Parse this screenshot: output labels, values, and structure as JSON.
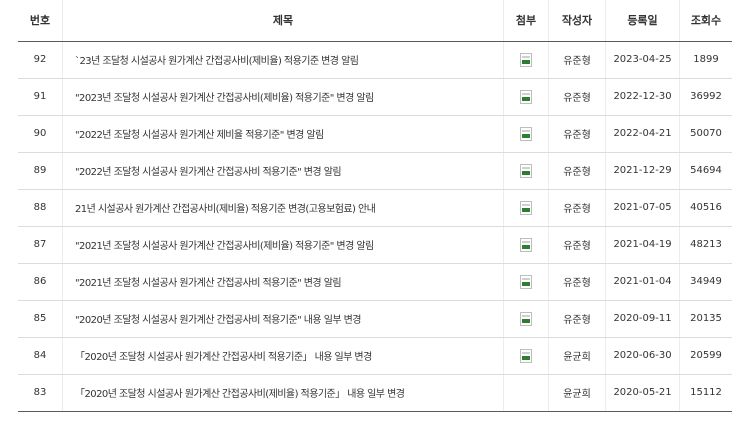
{
  "table": {
    "headers": {
      "number": "번호",
      "title": "제목",
      "attachment": "첨부",
      "author": "작성자",
      "date": "등록일",
      "views": "조회수"
    },
    "rows": [
      {
        "number": "92",
        "title": "`23년 조달청 시설공사 원가계산 간접공사비(제비율) 적용기준 변경 알림",
        "author": "유준형",
        "date": "2023-04-25",
        "views": "1899",
        "attachment": true
      },
      {
        "number": "91",
        "title": "\"2023년 조달청 시설공사 원가계산 간접공사비(제비율) 적용기준\" 변경 알림",
        "author": "유준형",
        "date": "2022-12-30",
        "views": "36992",
        "attachment": true
      },
      {
        "number": "90",
        "title": "\"2022년 조달청 시설공사 원가계산 제비율 적용기준\" 변경 알림",
        "author": "유준형",
        "date": "2022-04-21",
        "views": "50070",
        "attachment": true
      },
      {
        "number": "89",
        "title": "\"2022년 조달청 시설공사 원가계산 간접공사비 적용기준\" 변경 알림",
        "author": "유준형",
        "date": "2021-12-29",
        "views": "54694",
        "attachment": true
      },
      {
        "number": "88",
        "title": "21년 시설공사 원가계산 간접공사비(제비율) 적용기준 변경(고용보험료) 안내",
        "author": "유준형",
        "date": "2021-07-05",
        "views": "40516",
        "attachment": true
      },
      {
        "number": "87",
        "title": "\"2021년 조달청 시설공사 원가계산 간접공사비(제비율) 적용기준\" 변경 알림",
        "author": "유준형",
        "date": "2021-04-19",
        "views": "48213",
        "attachment": true
      },
      {
        "number": "86",
        "title": "\"2021년 조달청 시설공사 원가계산 간접공사비 적용기준\" 변경 알림",
        "author": "유준형",
        "date": "2021-01-04",
        "views": "34949",
        "attachment": true
      },
      {
        "number": "85",
        "title": "\"2020년 조달청 시설공사 원가계산 간접공사비 적용기준\" 내용 일부 변경",
        "author": "유준형",
        "date": "2020-09-11",
        "views": "20135",
        "attachment": true
      },
      {
        "number": "84",
        "title": "「2020년 조달청 시설공사 원가계산 간접공사비 적용기준」 내용 일부 변경",
        "author": "윤균희",
        "date": "2020-06-30",
        "views": "20599",
        "attachment": true
      },
      {
        "number": "83",
        "title": "「2020년 조달청 시설공사 원가계산 간접공사비(제비율) 적용기준」 내용 일부 변경",
        "author": "윤균희",
        "date": "2020-05-21",
        "views": "15112",
        "attachment": false
      }
    ]
  }
}
